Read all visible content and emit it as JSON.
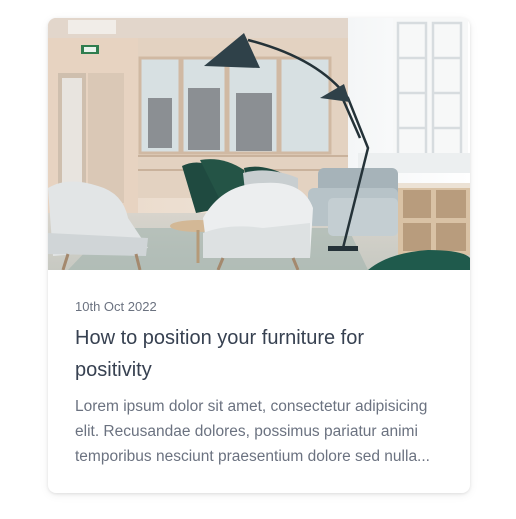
{
  "post": {
    "date": "10th Oct 2022",
    "title": "How to position your furniture for positivity",
    "excerpt": "Lorem ipsum dolor sit amet, consectetur adipisicing elit. Recusandae dolores, possimus pariatur animi temporibus nesciunt praesentium dolore sed nulla..."
  },
  "colors": {
    "date": "#6b7280",
    "title": "#374151",
    "excerpt": "#6b7280",
    "card_background": "#ffffff"
  },
  "icons": {
    "image": "furniture-room-photo"
  }
}
